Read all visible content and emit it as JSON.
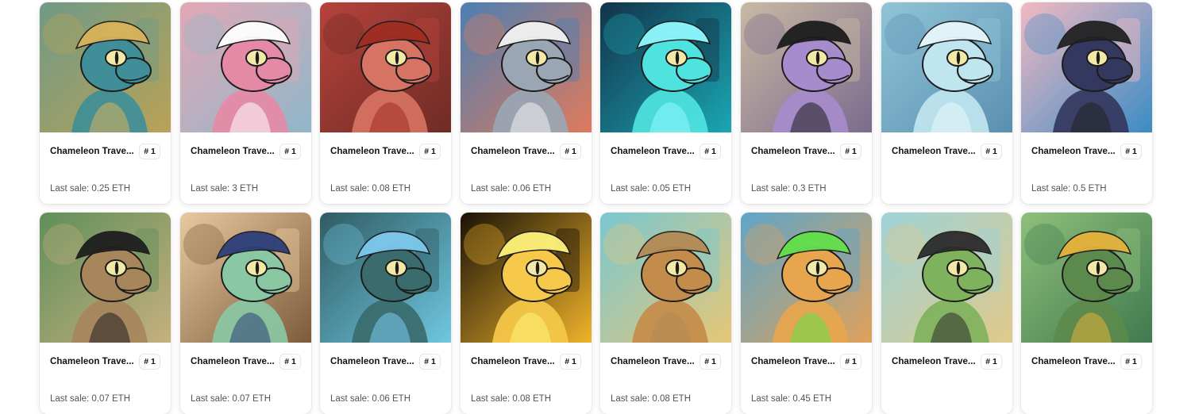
{
  "collection": {
    "cards": [
      {
        "name": "Chameleon Trave...",
        "token": "# 1",
        "last_sale": "Last sale: 0.25 ETH",
        "art": "crowned-blue-chameleon",
        "bg": "#6f9a86",
        "bg2": "#b9a256",
        "skin": "#3f8e98",
        "accent": "#d8b35a"
      },
      {
        "name": "Chameleon Trave...",
        "token": "# 1",
        "last_sale": "Last sale: 3 ETH",
        "art": "fox-mask-pink-chameleon",
        "bg": "#e3a7b6",
        "bg2": "#8fb7c9",
        "skin": "#e58aa6",
        "accent": "#ffffff"
      },
      {
        "name": "Chameleon Trave...",
        "token": "# 1",
        "last_sale": "Last sale: 0.08 ETH",
        "art": "demon-horn-chameleon",
        "bg": "#b6423c",
        "bg2": "#6f2b25",
        "skin": "#d77362",
        "accent": "#9f2d22"
      },
      {
        "name": "Chameleon Trave...",
        "token": "# 1",
        "last_sale": "Last sale: 0.06 ETH",
        "art": "white-curly-hair-chameleon",
        "bg": "#4c7fb3",
        "bg2": "#e07a5c",
        "skin": "#9aa6b4",
        "accent": "#f2f2f2"
      },
      {
        "name": "Chameleon Trave...",
        "token": "# 1",
        "last_sale": "Last sale: 0.05 ETH",
        "art": "ghost-cyan-chameleon",
        "bg": "#13324a",
        "bg2": "#1aa7b3",
        "skin": "#4fe3e0",
        "accent": "#8ffaff"
      },
      {
        "name": "Chameleon Trave...",
        "token": "# 1",
        "last_sale": "Last sale: 0.3 ETH",
        "art": "pirate-skull-chameleon",
        "bg": "#c9b9a3",
        "bg2": "#7a6b8e",
        "skin": "#a68ccc",
        "accent": "#1d1d1d"
      },
      {
        "name": "Chameleon Trave...",
        "token": "# 1",
        "last_sale": "",
        "art": "pale-ghost-chameleon",
        "bg": "#8fc5d6",
        "bg2": "#5b8fb1",
        "skin": "#bfe5ef",
        "accent": "#e8f7fb"
      },
      {
        "name": "Chameleon Trave...",
        "token": "# 1",
        "last_sale": "Last sale: 0.5 ETH",
        "art": "pirate-captain-chameleon",
        "bg": "#f2b9c3",
        "bg2": "#3b8cc4",
        "skin": "#34375e",
        "accent": "#222222"
      },
      {
        "name": "Chameleon Trave...",
        "token": "# 1",
        "last_sale": "Last sale: 0.07 ETH",
        "art": "headphones-cap-chameleon",
        "bg": "#5f8f5a",
        "bg2": "#c6b07e",
        "skin": "#a7865c",
        "accent": "#1f1f1f"
      },
      {
        "name": "Chameleon Trave...",
        "token": "# 1",
        "last_sale": "Last sale: 0.07 ETH",
        "art": "wizard-hat-chameleon",
        "bg": "#e9c9a0",
        "bg2": "#7b5b3a",
        "skin": "#8ac8a3",
        "accent": "#2d3f7a"
      },
      {
        "name": "Chameleon Trave...",
        "token": "# 1",
        "last_sale": "Last sale: 0.06 ETH",
        "art": "gas-mask-scientist-chameleon",
        "bg": "#2f5b62",
        "bg2": "#6fc7e0",
        "skin": "#3a6c6e",
        "accent": "#7cc8ec"
      },
      {
        "name": "Chameleon Trave...",
        "token": "# 1",
        "last_sale": "Last sale: 0.08 ETH",
        "art": "golden-laser-chameleon",
        "bg": "#1a1208",
        "bg2": "#f0b42a",
        "skin": "#f6c94a",
        "accent": "#fff27a"
      },
      {
        "name": "Chameleon Trave...",
        "token": "# 1",
        "last_sale": "Last sale: 0.08 ETH",
        "art": "safari-hat-chameleon",
        "bg": "#79c7d1",
        "bg2": "#e6c777",
        "skin": "#c48c4a",
        "accent": "#b48a55"
      },
      {
        "name": "Chameleon Trave...",
        "token": "# 1",
        "last_sale": "Last sale: 0.45 ETH",
        "art": "green-shades-duck-chameleon",
        "bg": "#5fa5c9",
        "bg2": "#e0a15a",
        "skin": "#e7a64d",
        "accent": "#63e04a"
      },
      {
        "name": "Chameleon Trave...",
        "token": "# 1",
        "last_sale": "",
        "art": "skull-cap-green-chameleon",
        "bg": "#9ed3d8",
        "bg2": "#e0c98a",
        "skin": "#7fb25c",
        "accent": "#2c2c2c"
      },
      {
        "name": "Chameleon Trave...",
        "token": "# 1",
        "last_sale": "",
        "art": "cowboy-gold-gun-chameleon",
        "bg": "#8fbf7a",
        "bg2": "#3f7a4f",
        "skin": "#5c8a4c",
        "accent": "#e3b23a"
      }
    ]
  }
}
